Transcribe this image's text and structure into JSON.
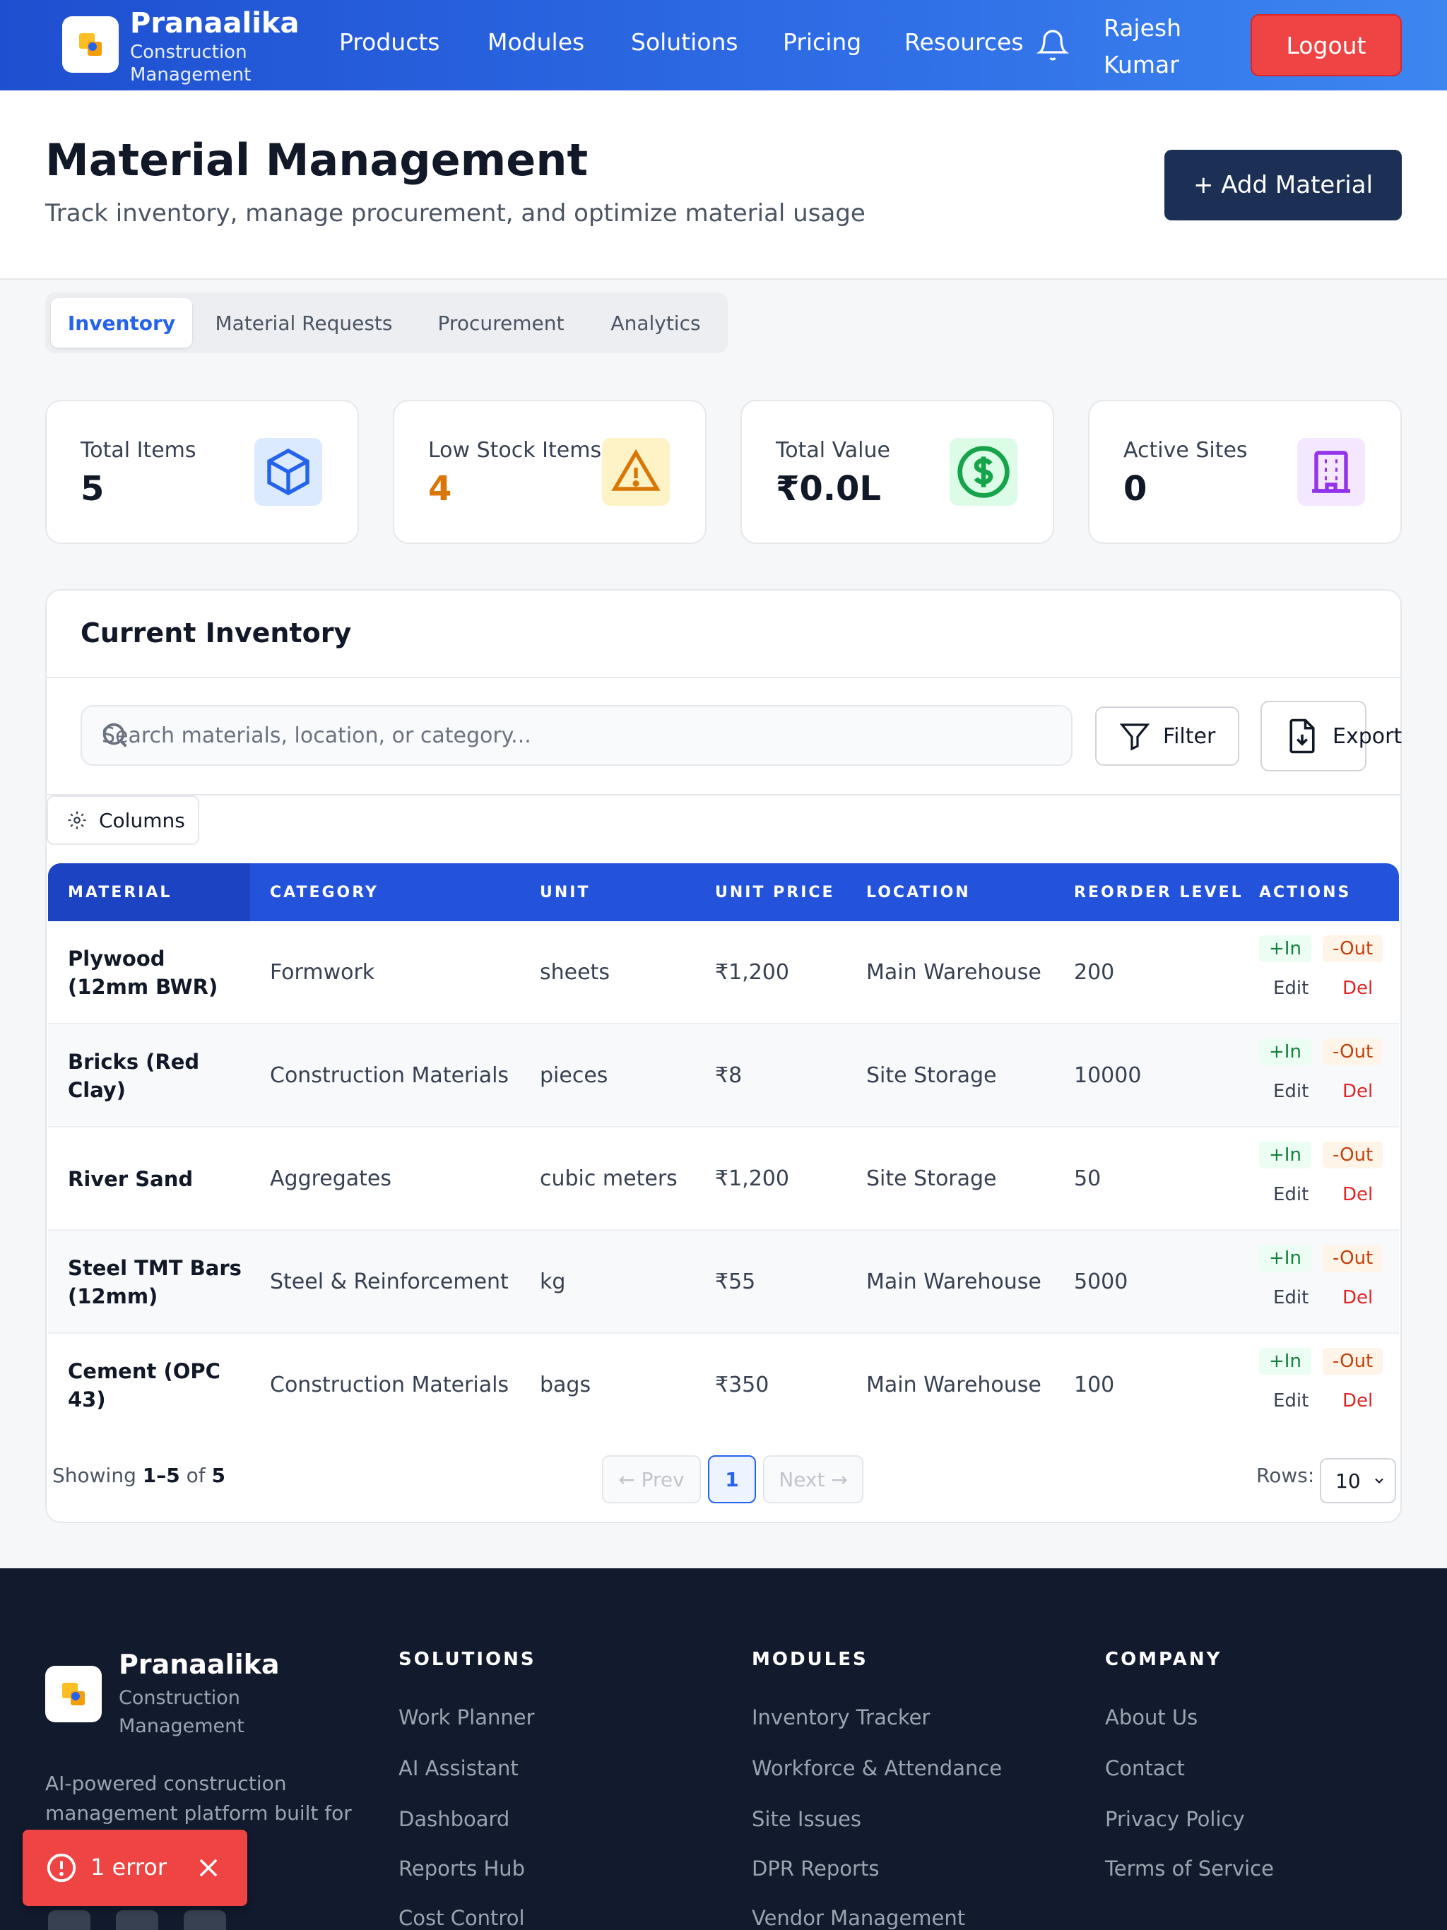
{
  "header": {
    "brand": "Pranaalika",
    "brand_sub": "Construction Management",
    "nav": [
      "Products",
      "Modules",
      "Solutions",
      "Pricing",
      "Resources"
    ],
    "user": "Rajesh Kumar",
    "logout": "Logout"
  },
  "page": {
    "title": "Material Management",
    "subtitle": "Track inventory, manage procurement, and optimize material usage",
    "add_button": "+ Add Material"
  },
  "tabs": [
    "Inventory",
    "Material Requests",
    "Procurement",
    "Analytics"
  ],
  "active_tab": "Inventory",
  "stats": [
    {
      "label": "Total Items",
      "value": "5",
      "icon": "cube-icon",
      "color": "#2563eb"
    },
    {
      "label": "Low Stock Items",
      "value": "4",
      "icon": "warning-icon",
      "color": "#d97706"
    },
    {
      "label": "Total Value",
      "value": "₹0.0L",
      "icon": "dollar-icon",
      "color": "#16a34a"
    },
    {
      "label": "Active Sites",
      "value": "0",
      "icon": "building-icon",
      "color": "#9333ea"
    }
  ],
  "inventory": {
    "title": "Current Inventory",
    "search_placeholder": "Search materials, location, or category...",
    "filter": "Filter",
    "export": "Export",
    "columns": "Columns",
    "headers": [
      "MATERIAL",
      "CATEGORY",
      "UNIT",
      "UNIT PRICE",
      "LOCATION",
      "REORDER LEVEL",
      "ACTIONS"
    ],
    "rows": [
      {
        "material": "Plywood (12mm BWR)",
        "category": "Formwork",
        "unit": "sheets",
        "price": "₹1,200",
        "location": "Main Warehouse",
        "reorder": "200"
      },
      {
        "material": "Bricks (Red Clay)",
        "category": "Construction Materials",
        "unit": "pieces",
        "price": "₹8",
        "location": "Site Storage",
        "reorder": "10000"
      },
      {
        "material": "River Sand",
        "category": "Aggregates",
        "unit": "cubic meters",
        "price": "₹1,200",
        "location": "Site Storage",
        "reorder": "50"
      },
      {
        "material": "Steel TMT Bars (12mm)",
        "category": "Steel & Reinforcement",
        "unit": "kg",
        "price": "₹55",
        "location": "Main Warehouse",
        "reorder": "5000"
      },
      {
        "material": "Cement (OPC 43)",
        "category": "Construction Materials",
        "unit": "bags",
        "price": "₹350",
        "location": "Main Warehouse",
        "reorder": "100"
      }
    ],
    "actions": {
      "in": "+In",
      "out": "-Out",
      "edit": "Edit",
      "del": "Del"
    },
    "pagination": {
      "showing_prefix": "Showing",
      "range": "1–5",
      "of": "of",
      "total": "5",
      "prev": "← Prev",
      "page": "1",
      "next": "Next →",
      "rows_label": "Rows:",
      "rows_value": "10"
    }
  },
  "footer": {
    "brand": "Pranaalika",
    "brand_sub": "Construction Management",
    "desc": "AI-powered construction management platform built for",
    "columns": [
      {
        "title": "SOLUTIONS",
        "links": [
          "Work Planner",
          "AI Assistant",
          "Dashboard",
          "Reports Hub",
          "Cost Control"
        ]
      },
      {
        "title": "MODULES",
        "links": [
          "Inventory Tracker",
          "Workforce & Attendance",
          "Site Issues",
          "DPR Reports",
          "Vendor Management"
        ]
      },
      {
        "title": "COMPANY",
        "links": [
          "About Us",
          "Contact",
          "Privacy Policy",
          "Terms of Service"
        ]
      }
    ]
  },
  "toast": {
    "text": "1 error"
  }
}
